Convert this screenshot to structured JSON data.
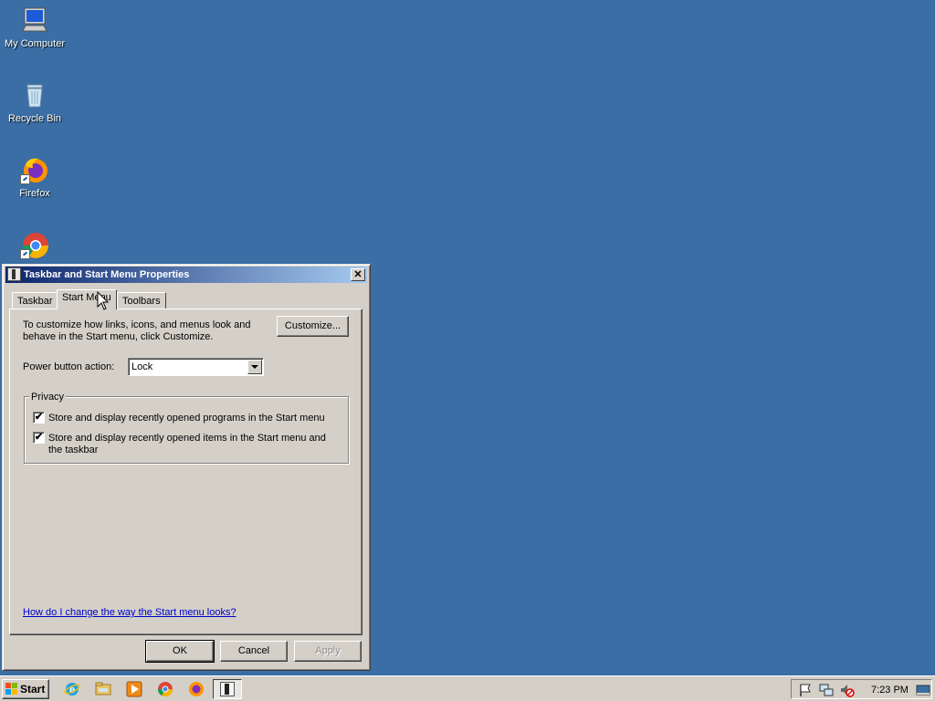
{
  "desktop": {
    "icons": [
      {
        "label": "My Computer",
        "icon": "computer-icon"
      },
      {
        "label": "Recycle Bin",
        "icon": "recycle-bin-icon"
      },
      {
        "label": "Firefox",
        "icon": "firefox-icon"
      },
      {
        "label": "",
        "icon": "chrome-icon"
      }
    ],
    "background_color": "#3a6ea5"
  },
  "dialog": {
    "title": "Taskbar and Start Menu Properties",
    "close_label": "✕",
    "tabs": [
      {
        "label": "Taskbar",
        "active": false
      },
      {
        "label": "Start Menu",
        "active": true
      },
      {
        "label": "Toolbars",
        "active": false
      }
    ],
    "intro_text_line1": "To customize how links, icons, and menus look and",
    "intro_text_line2": "behave in the Start menu, click Customize.",
    "customize_label": "Customize...",
    "power_label": "Power button action:",
    "power_value": "Lock",
    "privacy_legend": "Privacy",
    "privacy_options": [
      {
        "line1": "Store and display recently opened programs in the Start menu",
        "line2": "",
        "checked": true
      },
      {
        "line1": "Store and display recently opened items in the Start menu and",
        "line2": "the taskbar",
        "checked": true
      }
    ],
    "help_link": "How do I change the way the Start menu looks?",
    "ok_label": "OK",
    "cancel_label": "Cancel",
    "apply_label": "Apply",
    "check_glyph": "✔"
  },
  "taskbar": {
    "start_label": "Start",
    "quick_launch": [
      "internet-explorer-icon",
      "file-explorer-icon",
      "media-player-icon",
      "chrome-icon",
      "firefox-icon"
    ],
    "clock": "7:23 PM",
    "tray_icons": [
      "action-center-flag-icon",
      "network-icon",
      "volume-muted-icon",
      "show-desktop-icon"
    ]
  }
}
